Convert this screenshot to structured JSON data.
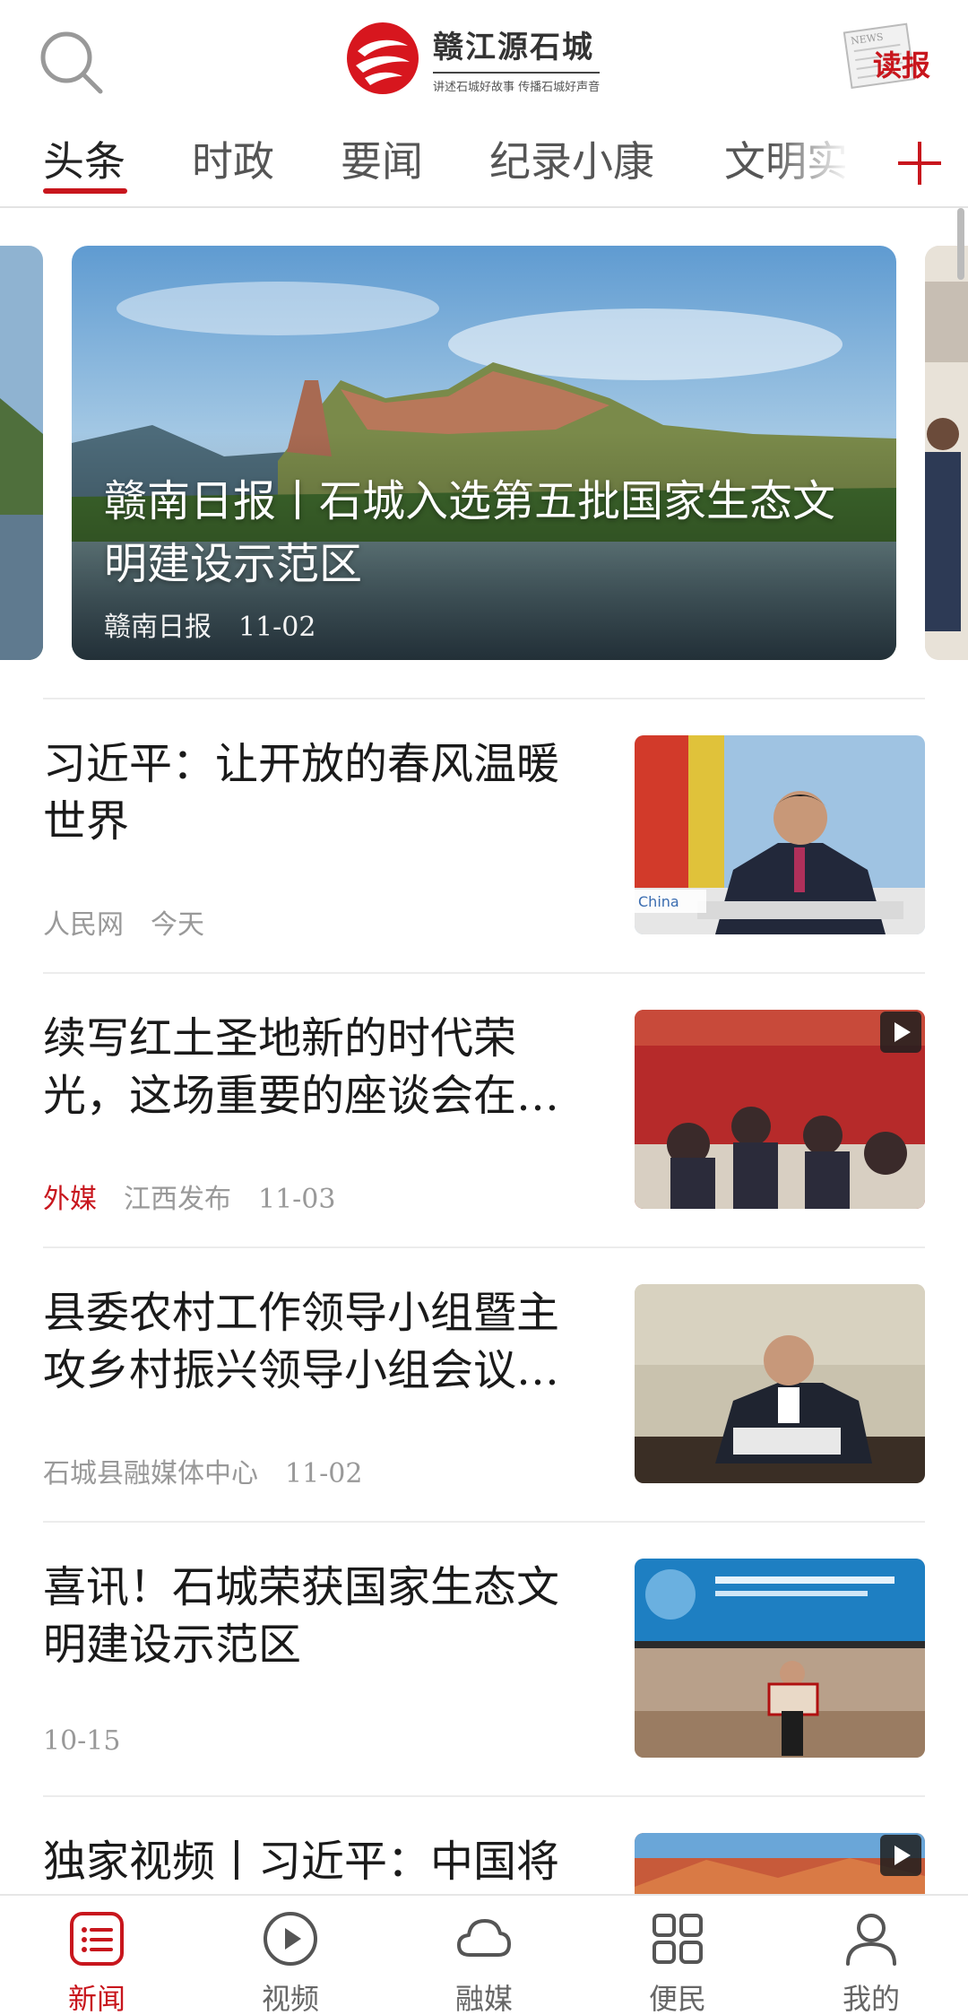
{
  "header": {
    "app_title": "赣江源石城",
    "app_slogan": "讲述石城好故事 传播石城好声音",
    "read_paper_label": "读报",
    "read_paper_small": "NEWS"
  },
  "tabs": [
    {
      "label": "头条",
      "active": true
    },
    {
      "label": "时政",
      "active": false
    },
    {
      "label": "要闻",
      "active": false
    },
    {
      "label": "纪录小康",
      "active": false
    },
    {
      "label": "文明实",
      "active": false
    }
  ],
  "carousel": {
    "title": "赣南日报丨石城入选第五批国家生态文明建设示范区",
    "source": "赣南日报",
    "date": "11-02"
  },
  "news": [
    {
      "title": "习近平：让开放的春风温暖世界",
      "tag": "",
      "source": "人民网",
      "date": "今天",
      "video": false,
      "thumb_caption": "China"
    },
    {
      "title": "续写红土圣地新的时代荣光，这场重要的座谈会在…",
      "tag": "外媒",
      "source": "江西发布",
      "date": "11-03",
      "video": true
    },
    {
      "title": "县委农村工作领导小组暨主攻乡村振兴领导小组会议…",
      "tag": "",
      "source": "石城县融媒体中心",
      "date": "11-02",
      "video": false
    },
    {
      "title": "喜讯！石城荣获国家生态文明建设示范区",
      "tag": "",
      "source": "",
      "date": "10-15",
      "video": false
    },
    {
      "title": "独家视频丨习近平：中国将",
      "tag": "",
      "source": "",
      "date": "",
      "video": true
    }
  ],
  "bottom_nav": [
    {
      "label": "新闻",
      "icon": "news-list-icon",
      "active": true
    },
    {
      "label": "视频",
      "icon": "play-circle-icon",
      "active": false
    },
    {
      "label": "融媒",
      "icon": "cloud-icon",
      "active": false
    },
    {
      "label": "便民",
      "icon": "grid-icon",
      "active": false
    },
    {
      "label": "我的",
      "icon": "user-icon",
      "active": false
    }
  ],
  "colors": {
    "accent": "#c8161d",
    "meta_gray": "#999999"
  }
}
